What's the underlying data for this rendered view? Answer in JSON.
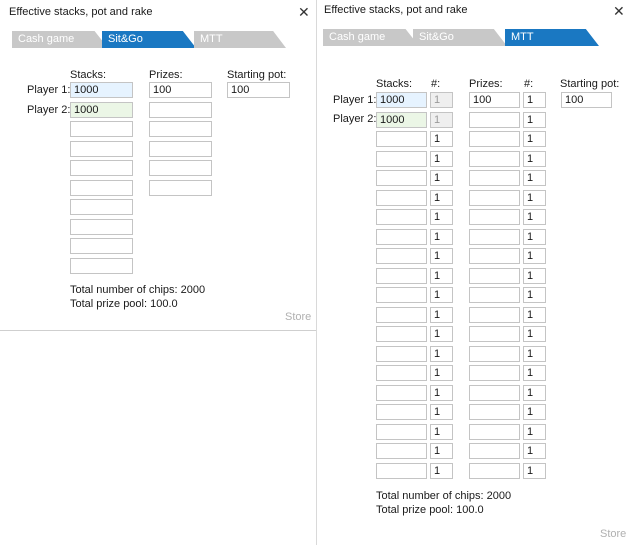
{
  "left": {
    "title": "Effective stacks, pot and rake",
    "close_glyph": "✕",
    "tabs": [
      "Cash game",
      "Sit&Go",
      "MTT"
    ],
    "active_tab": "Sit&Go",
    "stacks_label": "Stacks:",
    "prizes_label": "Prizes:",
    "starting_pot_label": "Starting pot:",
    "player1_label": "Player 1:",
    "player2_label": "Player 2:",
    "stacks": [
      "1000",
      "1000",
      "",
      "",
      "",
      "",
      "",
      "",
      "",
      ""
    ],
    "prizes": [
      "100",
      "",
      "",
      "",
      "",
      ""
    ],
    "starting_pot": "100",
    "total_chips": "Total number of chips: 2000",
    "total_prize": "Total prize pool: 100.0",
    "store": "Store"
  },
  "right": {
    "title": "Effective stacks, pot and rake",
    "close_glyph": "✕",
    "tabs": [
      "Cash game",
      "Sit&Go",
      "MTT"
    ],
    "active_tab": "MTT",
    "stacks_label": "Stacks:",
    "count_label": "#:",
    "prizes_label": "Prizes:",
    "prize_count_label": "#:",
    "starting_pot_label": "Starting pot:",
    "player1_label": "Player 1:",
    "player2_label": "Player 2:",
    "stacks": [
      "1000",
      "1000",
      "",
      "",
      "",
      "",
      "",
      "",
      "",
      "",
      "",
      "",
      "",
      "",
      "",
      "",
      "",
      "",
      "",
      ""
    ],
    "stack_counts": [
      "1",
      "1",
      "1",
      "1",
      "1",
      "1",
      "1",
      "1",
      "1",
      "1",
      "1",
      "1",
      "1",
      "1",
      "1",
      "1",
      "1",
      "1",
      "1",
      "1"
    ],
    "prizes": [
      "100",
      "",
      "",
      "",
      "",
      "",
      "",
      "",
      "",
      "",
      "",
      "",
      "",
      "",
      "",
      "",
      "",
      "",
      "",
      ""
    ],
    "prize_counts": [
      "1",
      "1",
      "1",
      "1",
      "1",
      "1",
      "1",
      "1",
      "1",
      "1",
      "1",
      "1",
      "1",
      "1",
      "1",
      "1",
      "1",
      "1",
      "1",
      "1"
    ],
    "starting_pot": "100",
    "total_chips": "Total number of chips: 2000",
    "total_prize": "Total prize pool: 100.0",
    "store": "Store"
  },
  "colors": {
    "active_tab": "#1a78c2",
    "inactive_tab": "#c8c8c8",
    "player1_field": "#e6f3ff",
    "player2_field": "#ebf6e6"
  }
}
